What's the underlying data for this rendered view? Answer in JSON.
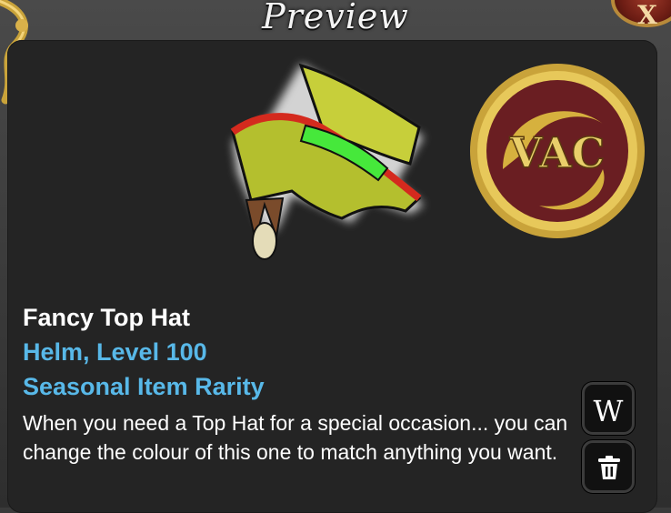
{
  "window": {
    "title": "Preview",
    "close_label": "X"
  },
  "item": {
    "name": "Fancy Top Hat",
    "type_level": "Helm, Level 100",
    "rarity": "Seasonal Item Rarity",
    "description": "When you need a Top Hat for a special occasion... you can change the colour of this one to match anything you want.",
    "image_icon": "green-top-hat-icon",
    "badge_icon": "vac-badge-icon",
    "badge_text": "VAC"
  },
  "actions": {
    "wiki_label": "W",
    "wiki_icon": "wiki-icon",
    "delete_icon": "trash-icon"
  },
  "colors": {
    "accent": "#58b8e8",
    "panel": "#242424",
    "gold": "#c9a33a"
  }
}
